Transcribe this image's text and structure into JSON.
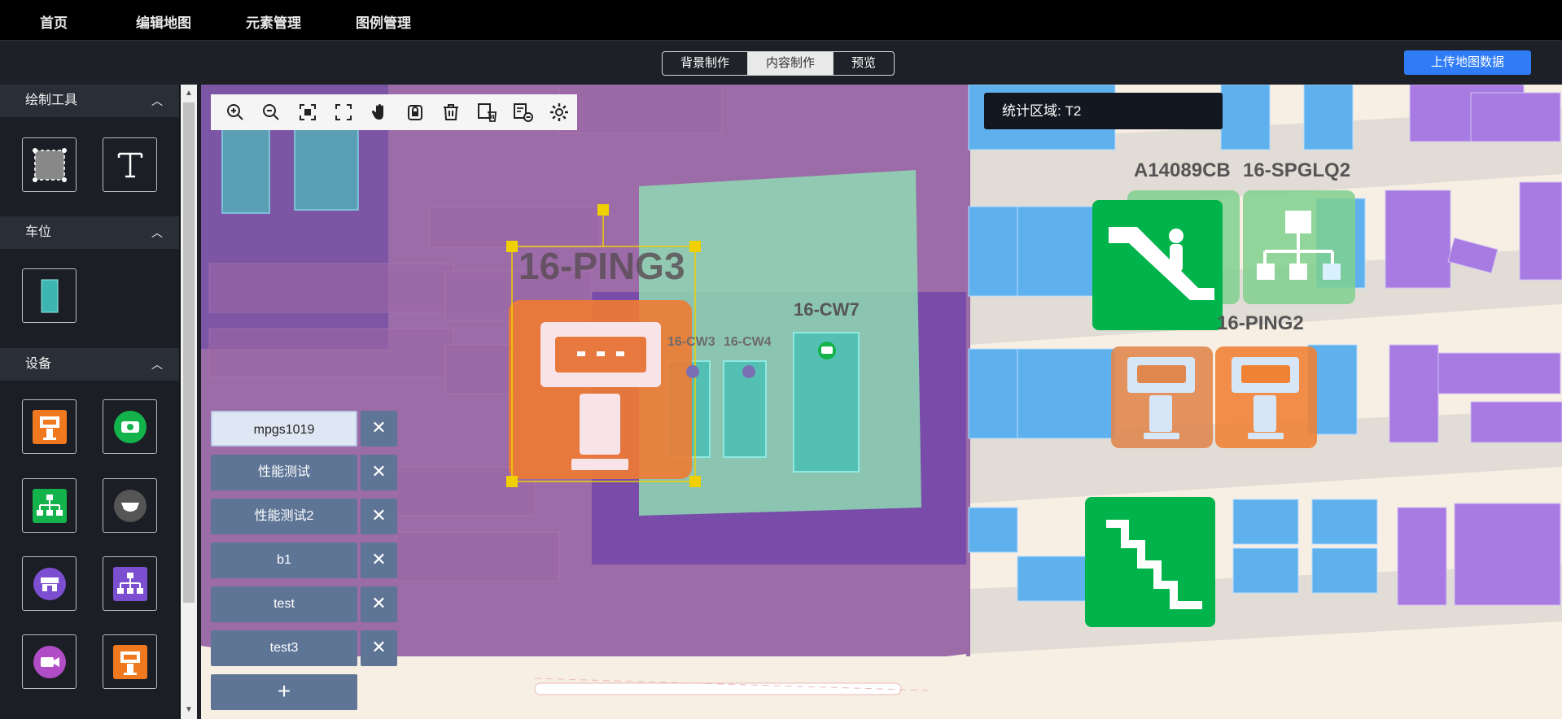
{
  "nav": {
    "items": [
      "首页",
      "编辑地图",
      "元素管理",
      "图例管理"
    ]
  },
  "modes": {
    "items": [
      "背景制作",
      "内容制作",
      "预览"
    ],
    "active": "内容制作"
  },
  "upload_button": "上传地图数据",
  "panel": {
    "sections": [
      {
        "title": "绘制工具",
        "tools": [
          "rectangle-select-icon",
          "text-tool-icon"
        ]
      },
      {
        "title": "车位",
        "tools": [
          "parking-space-icon"
        ]
      },
      {
        "title": "设备",
        "tools": [
          "kiosk-orange-icon",
          "camera-green-icon",
          "network-green-icon",
          "dome-camera-gray-icon",
          "store-purple-icon",
          "network-purple-icon",
          "video-purple-icon",
          "kiosk-orange-icon-2"
        ]
      }
    ]
  },
  "stats": {
    "label": "统计区域: T2"
  },
  "toolbar": [
    "zoom-in-icon",
    "zoom-out-icon",
    "fit-icon",
    "fullscreen-icon",
    "pan-hand-icon",
    "lock-icon",
    "delete-icon",
    "delete-layer-icon",
    "remove-layer-icon",
    "settings-icon"
  ],
  "layers": {
    "items": [
      "mpgs1019",
      "性能测试",
      "性能测试2",
      "b1",
      "test",
      "test3"
    ],
    "active": "mpgs1019",
    "close": "✕",
    "add": "+"
  },
  "map": {
    "labels": {
      "ping3": "16-PING3",
      "cw7": "16-CW7",
      "cw3": "16-CW3",
      "cw4": "16-CW4",
      "a14089": "A14089CB",
      "spglq2": "16-SPGLQ2",
      "ping2": "16-PING2"
    }
  },
  "colors": {
    "purple_area": "#8e5a9e",
    "teal_area": "#8fcfaa",
    "orange_device": "#f08236",
    "green_device": "#00b34a",
    "blue_slot": "#5fb1ee",
    "violet_slot": "#a77be2"
  }
}
